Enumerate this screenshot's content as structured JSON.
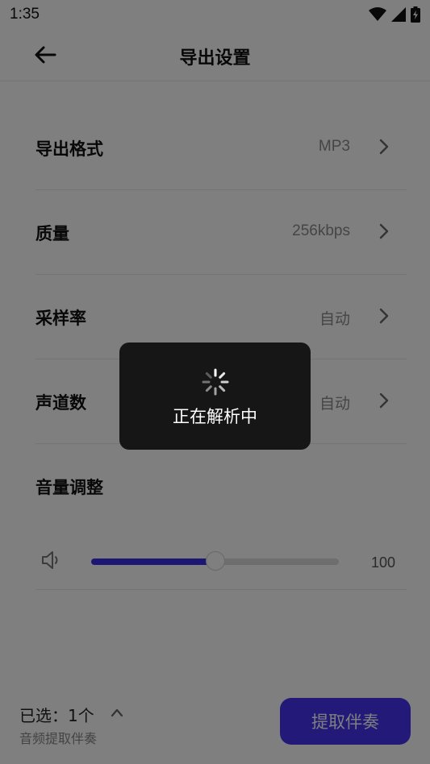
{
  "status_bar": {
    "time": "1:35",
    "icons": [
      "wifi-icon",
      "signal-icon",
      "battery-charging-icon"
    ]
  },
  "header": {
    "title": "导出设置",
    "back_icon": "arrow-left-icon"
  },
  "settings": {
    "rows": [
      {
        "label": "导出格式",
        "value": "MP3"
      },
      {
        "label": "质量",
        "value": "256kbps"
      },
      {
        "label": "采样率",
        "value": "自动"
      },
      {
        "label": "声道数",
        "value": "自动"
      }
    ],
    "volume": {
      "label": "音量调整",
      "value": "100",
      "level_fraction": 0.5
    }
  },
  "bottom_bar": {
    "selected_label": "已选：1个",
    "sub_label": "音频提取伴奏",
    "action_label": "提取伴奏"
  },
  "loading": {
    "text": "正在解析中"
  },
  "colors": {
    "accent": "#3b2ee8",
    "button": "#4433f0",
    "overlay": "rgba(0,0,0,0.5)",
    "toast": "#161616"
  }
}
